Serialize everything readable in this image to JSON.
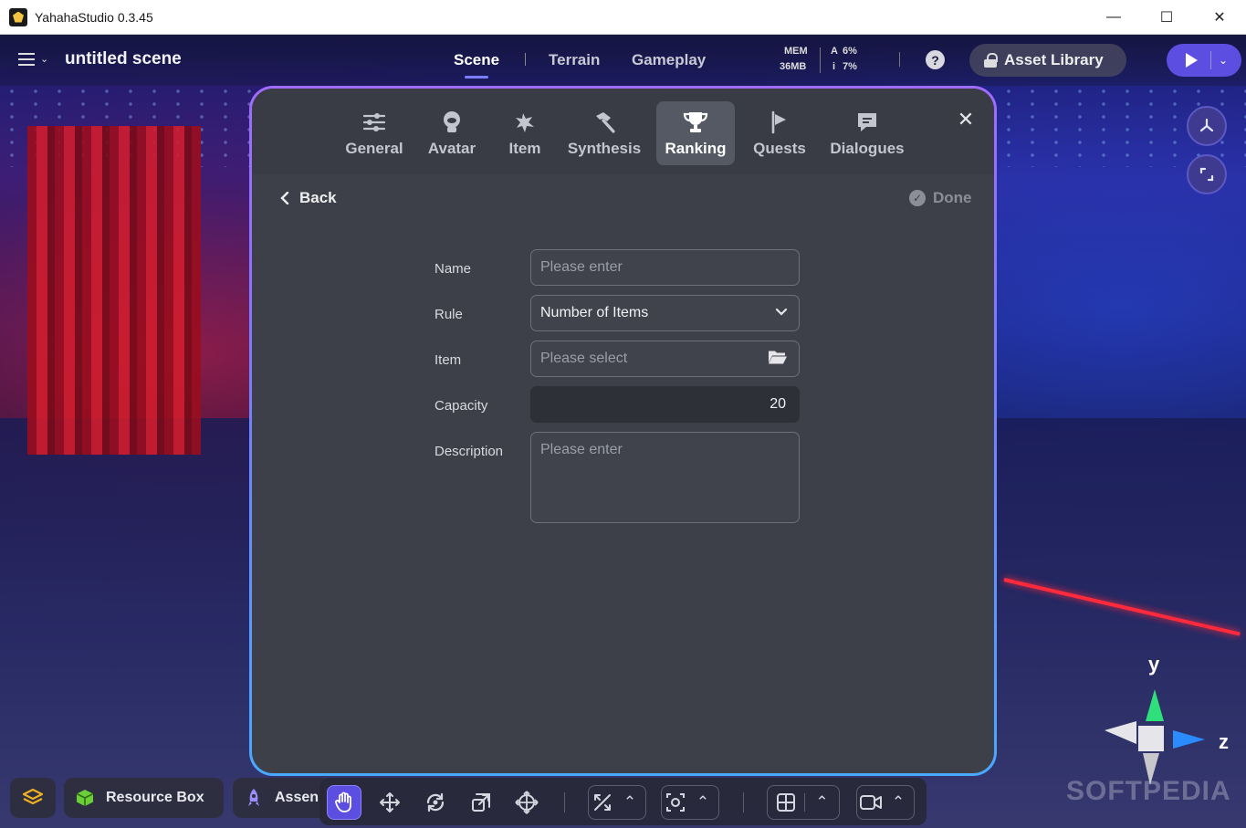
{
  "window": {
    "title": "YahahaStudio 0.3.45",
    "controls": [
      "—",
      "☐",
      "✕"
    ]
  },
  "topbar": {
    "scene_name": "untitled scene",
    "tabs": [
      {
        "label": "Scene",
        "active": true
      },
      {
        "label": "Terrain",
        "active": false
      },
      {
        "label": "Gameplay",
        "active": false
      }
    ],
    "perf": {
      "mem_label": "MEM",
      "mem_value": "36MB",
      "a_label": "A",
      "a_value": "6%",
      "i_label": "i",
      "i_value": "7%"
    },
    "help_icon": "?",
    "asset_library_label": "Asset Library"
  },
  "modal": {
    "tabs": [
      {
        "label": "General",
        "icon": "sliders-icon",
        "active": false
      },
      {
        "label": "Avatar",
        "icon": "avatar-icon",
        "active": false
      },
      {
        "label": "Item",
        "icon": "item-icon",
        "active": false
      },
      {
        "label": "Synthesis",
        "icon": "hammer-icon",
        "active": false
      },
      {
        "label": "Ranking",
        "icon": "trophy-icon",
        "active": true
      },
      {
        "label": "Quests",
        "icon": "flag-icon",
        "active": false
      },
      {
        "label": "Dialogues",
        "icon": "chat-icon",
        "active": false
      }
    ],
    "back_label": "Back",
    "done_label": "Done",
    "form": {
      "name_label": "Name",
      "name_placeholder": "Please enter",
      "rule_label": "Rule",
      "rule_value": "Number of Items",
      "item_label": "Item",
      "item_placeholder": "Please select",
      "capacity_label": "Capacity",
      "capacity_value": "20",
      "description_label": "Description",
      "description_placeholder": "Please enter"
    }
  },
  "bottombar": {
    "resource_box_label": "Resource Box",
    "assets_label": "Assen"
  },
  "gizmo": {
    "y_label": "y",
    "z_label": "z"
  },
  "watermark": "SOFTPEDIA",
  "colors": {
    "accent": "#5b4ee0",
    "modal_bg": "#3d4049",
    "modal_border_top": "#a06bff",
    "modal_border_bottom": "#4aa8ff",
    "gizmo_y": "#2fe07a",
    "gizmo_z": "#2a8cff"
  }
}
